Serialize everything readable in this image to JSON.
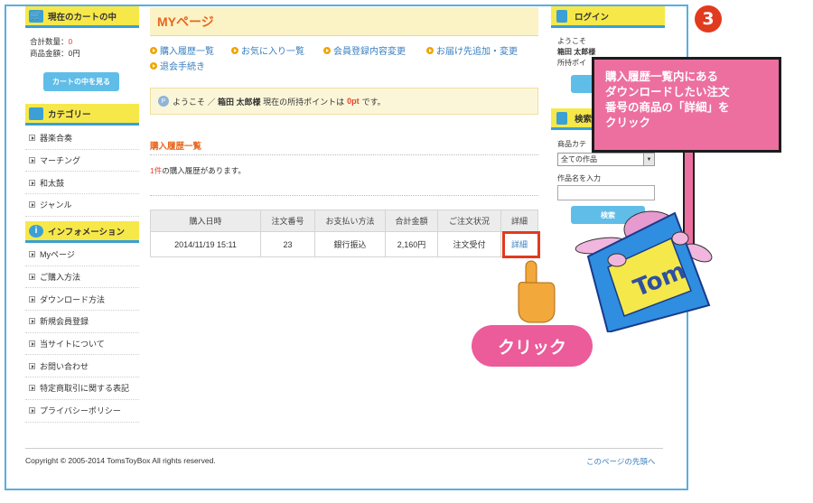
{
  "step": {
    "number": "3"
  },
  "cart": {
    "title": "現在のカートの中",
    "total_qty_label": "合計数量：",
    "total_qty_value": "0",
    "total_price_label": "商品金額：",
    "total_price_value": "0円",
    "button_label": "カートの中を見る"
  },
  "categories": {
    "title": "カテゴリー",
    "items": [
      "器楽合奏",
      "マーチング",
      "和太鼓",
      "ジャンル"
    ]
  },
  "info": {
    "title": "インフォメーション",
    "items": [
      "Myページ",
      "ご購入方法",
      "ダウンロード方法",
      "新規会員登録",
      "当サイトについて",
      "お問い合わせ",
      "特定商取引に関する表記",
      "プライバシーポリシー"
    ]
  },
  "main": {
    "title": "MYページ",
    "nav": [
      "購入履歴一覧",
      "お気に入り一覧",
      "会員登録内容変更",
      "お届け先追加・変更",
      "退会手続き"
    ],
    "welcome": {
      "badge": "P",
      "prefix": "ようこそ ／",
      "name": "箱田 太郎様",
      "mid": "現在の所持ポイントは",
      "points": "0pt",
      "suffix": "です。"
    },
    "section_title": "購入履歴一覧",
    "count_num": "1件",
    "count_text": "の購入履歴があります。",
    "table": {
      "headers": [
        "購入日時",
        "注文番号",
        "お支払い方法",
        "合計金額",
        "ご注文状況",
        "詳細"
      ],
      "rows": [
        [
          "2014/11/19 15:11",
          "23",
          "銀行振込",
          "2,160円",
          "注文受付",
          "詳細"
        ]
      ]
    }
  },
  "right": {
    "login_title": "ログイン",
    "welcome": "ようこそ",
    "name": "箱田 太郎様",
    "points_label": "所持ポイ",
    "search_title": "検索",
    "category_label": "商品カテ",
    "select_value": "全ての作品",
    "name_label": "作品名を入力",
    "search_button": "検索"
  },
  "footer": {
    "copyright": "Copyright © 2005-2014 TomsToyBox All rights reserved.",
    "pagetop": "このページの先頭へ"
  },
  "callout": {
    "lines": [
      "購入履歴一覧内にある",
      "ダウンロードしたい注文",
      "番号の商品の「詳細」を",
      "クリック"
    ]
  },
  "click_bubble": "クリック",
  "mascot_text": "Tom",
  "colors": {
    "accent_yellow": "#f7e84a",
    "accent_blue": "#3aa0d5",
    "title_orange": "#e8661f",
    "link_blue": "#3a7fc0",
    "annotation_pink": "#ec6fa0",
    "step_red": "#e23a1e"
  }
}
